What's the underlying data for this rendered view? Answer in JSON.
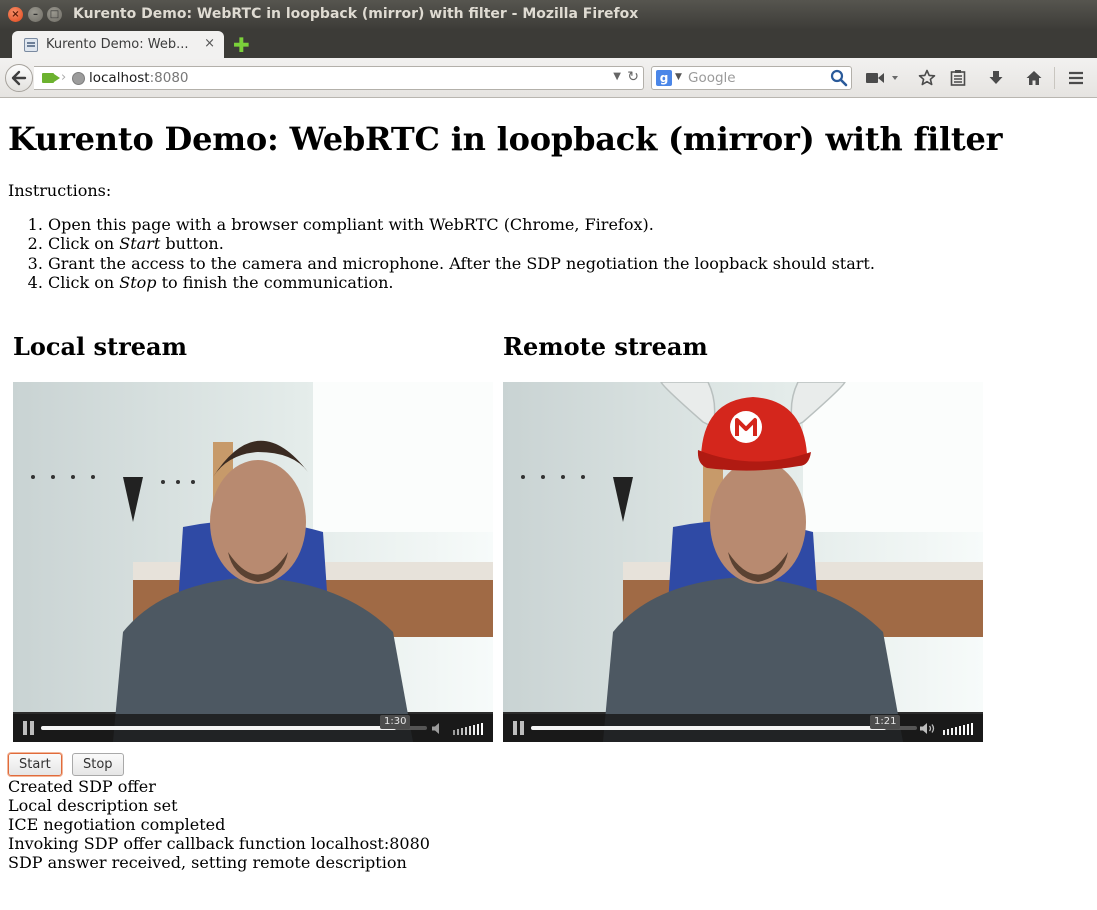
{
  "window": {
    "title": "Kurento Demo: WebRTC in loopback (mirror) with filter - Mozilla Firefox",
    "close_glyph": "×",
    "minimize_glyph": "–",
    "maximize_glyph": "□"
  },
  "tabs": [
    {
      "label": "Kurento Demo: Web...",
      "close_glyph": "×",
      "active": true
    }
  ],
  "new_tab_glyph": "✚",
  "navbar": {
    "url_host": "localhost",
    "url_port": ":8080",
    "search_placeholder": "Google",
    "search_engine_glyph": "g",
    "icons": [
      "back-arrow-icon",
      "camera-sharing-icon",
      "globe-icon",
      "url-dropdown-icon",
      "reload-icon",
      "search-engine-icon",
      "magnifier-icon",
      "video-camera-icon",
      "star-icon",
      "reading-list-icon",
      "download-icon",
      "home-icon",
      "hamburger-menu-icon"
    ]
  },
  "page": {
    "title": "Kurento Demo: WebRTC in loopback (mirror) with filter",
    "instructions_label": "Instructions:",
    "steps": [
      {
        "before": "Open this page with a browser compliant with WebRTC (Chrome, Firefox).",
        "em": "",
        "after": ""
      },
      {
        "before": "Click on ",
        "em": "Start",
        "after": " button."
      },
      {
        "before": "Grant the access to the camera and microphone. After the SDP negotiation the loopback should start.",
        "em": "",
        "after": ""
      },
      {
        "before": "Click on ",
        "em": "Stop",
        "after": " to finish the communication."
      }
    ],
    "local_stream_title": "Local stream",
    "remote_stream_title": "Remote stream",
    "local_video": {
      "time": "1:30",
      "progress": 0.92
    },
    "remote_video": {
      "time": "1:21",
      "progress": 0.92
    },
    "buttons": {
      "start": "Start",
      "stop": "Stop"
    },
    "log": [
      "Created SDP offer",
      "Local description set",
      "ICE negotiation completed",
      "Invoking SDP offer callback function localhost:8080",
      "SDP answer received, setting remote description"
    ]
  },
  "colors": {
    "titlebar": "#3d3c38",
    "close_button": "#e0461a",
    "start_focus": "#e06b3c",
    "hat_red": "#d4261c"
  }
}
